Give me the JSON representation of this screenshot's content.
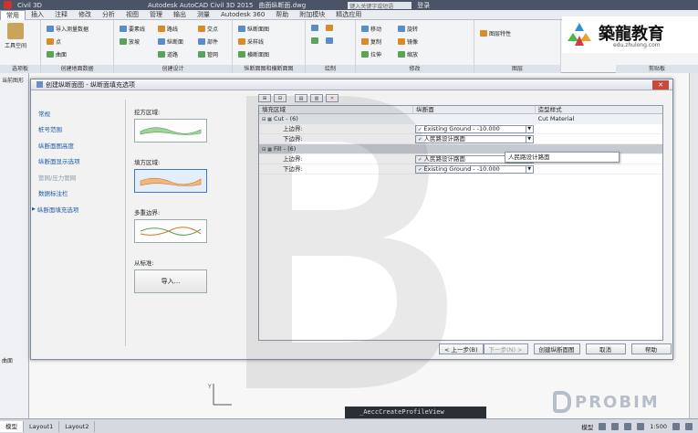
{
  "window": {
    "app_title": "Autodesk AutoCAD Civil 3D 2015",
    "file_name": "曲面纵断面.dwg",
    "workspace": "Civil 3D",
    "search_placeholder": "键入关键字或短语",
    "user": "登录"
  },
  "menu_tabs": [
    "常用",
    "插入",
    "注释",
    "修改",
    "分析",
    "视图",
    "管理",
    "输出",
    "测量",
    "Autodesk 360",
    "帮助",
    "附加模块",
    "精选应用"
  ],
  "ribbon": {
    "tool_space": "工具空间",
    "groups": [
      {
        "label": "选项板",
        "items": []
      },
      {
        "label": "创建地面数据",
        "items": [
          "导入测量数据",
          "点",
          "曲面"
        ]
      },
      {
        "label": "创建设计",
        "items": [
          "要素线",
          "放坡",
          "路线",
          "纵断面",
          "道路",
          "交点",
          "部件",
          "管网"
        ]
      },
      {
        "label": "纵断面图和横断面图",
        "items": [
          "纵断面图",
          "采样线",
          "横断面图"
        ]
      },
      {
        "label": "绘制",
        "items": []
      },
      {
        "label": "修改",
        "items": [
          "移动",
          "复制",
          "拉伸",
          "旋转",
          "镜像",
          "缩放"
        ]
      },
      {
        "label": "图层",
        "items": [
          "图层特性"
        ]
      },
      {
        "label": "剪贴板",
        "items": []
      }
    ]
  },
  "logo": {
    "name": "築龍教育",
    "url": "edu.zhulong.com"
  },
  "dialog": {
    "title": "创建纵断面图 - 纵断面填充选项",
    "nav": [
      {
        "label": "常规",
        "state": "normal"
      },
      {
        "label": "桩号范围",
        "state": "normal"
      },
      {
        "label": "纵断面图高度",
        "state": "normal"
      },
      {
        "label": "纵断面显示选项",
        "state": "normal"
      },
      {
        "label": "管网/压力管网",
        "state": "disabled"
      },
      {
        "label": "数据标注栏",
        "state": "normal"
      },
      {
        "label": "纵断面填充选项",
        "state": "current"
      }
    ],
    "options": {
      "cut_label": "挖方区域:",
      "fill_label": "填方区域:",
      "multi_label": "多重边界:",
      "from_label": "从标准:",
      "import_label": "导入..."
    },
    "grid": {
      "columns": [
        "填充区域",
        "纵断面",
        "造型样式"
      ],
      "rows": [
        {
          "type": "group",
          "name": "Cut - (6)",
          "style": "Cut Material",
          "selected": false
        },
        {
          "type": "child",
          "name": "上边界:",
          "profile": "Existing Ground - -10.000"
        },
        {
          "type": "child",
          "name": "下边界:",
          "profile": "人民路设计路面"
        },
        {
          "type": "group",
          "name": "Fill - (6)",
          "style": "",
          "selected": true
        },
        {
          "type": "child",
          "name": "上边界:",
          "profile": "人民路设计路面"
        },
        {
          "type": "child",
          "name": "下边界:",
          "profile": "Existing Ground - -10.000"
        }
      ],
      "dropdown_option": "人民路设计路面"
    },
    "buttons": {
      "back": "< 上一步(B)",
      "next": "下一步(N) >",
      "create": "创建纵断面图",
      "cancel": "取消",
      "help": "帮助"
    }
  },
  "command_line": "_AeccCreateProfileView",
  "status_bar": {
    "tabs": [
      "模型",
      "Layout1",
      "Layout2"
    ],
    "model_label": "模型",
    "scale": "1:500"
  },
  "left_panel": {
    "tree_label": "曲面",
    "header": "当前图形"
  },
  "watermark": "PROBIM"
}
